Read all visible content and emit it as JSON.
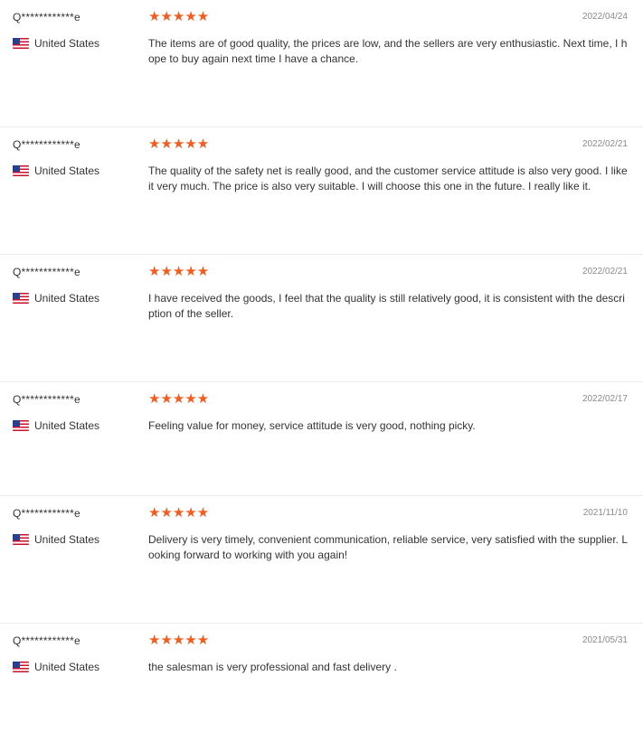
{
  "accent_color": "#f25c1f",
  "reviews": [
    {
      "user": "Q************e",
      "country": "United States",
      "stars": "★★★★★",
      "rating": 5,
      "date": "2022/04/24",
      "text": "The items are of good quality, the prices are low, and the sellers are very enthusiastic. Next time, I hope to buy again next time I have a chance."
    },
    {
      "user": "Q************e",
      "country": "United States",
      "stars": "★★★★★",
      "rating": 5,
      "date": "2022/02/21",
      "text": "The quality of the safety net is really good, and the customer service attitude is also very good. I like it very much. The price is also very suitable. I will choose this one in the future. I really like it."
    },
    {
      "user": "Q************e",
      "country": "United States",
      "stars": "★★★★★",
      "rating": 5,
      "date": "2022/02/21",
      "text": "I have received the goods, I feel that the quality is still relatively good, it is consistent with the description of the seller."
    },
    {
      "user": "Q************e",
      "country": "United States",
      "stars": "★★★★★",
      "rating": 5,
      "date": "2022/02/17",
      "text": "Feeling value for money, service attitude is very good, nothing picky."
    },
    {
      "user": "Q************e",
      "country": "United States",
      "stars": "★★★★★",
      "rating": 5,
      "date": "2021/11/10",
      "text": "Delivery is very timely, convenient communication, reliable service, very satisfied with the supplier. Looking forward to working with you again!"
    },
    {
      "user": "Q************e",
      "country": "United States",
      "stars": "★★★★★",
      "rating": 5,
      "date": "2021/05/31",
      "text": "the salesman is very professional and fast delivery ."
    }
  ]
}
